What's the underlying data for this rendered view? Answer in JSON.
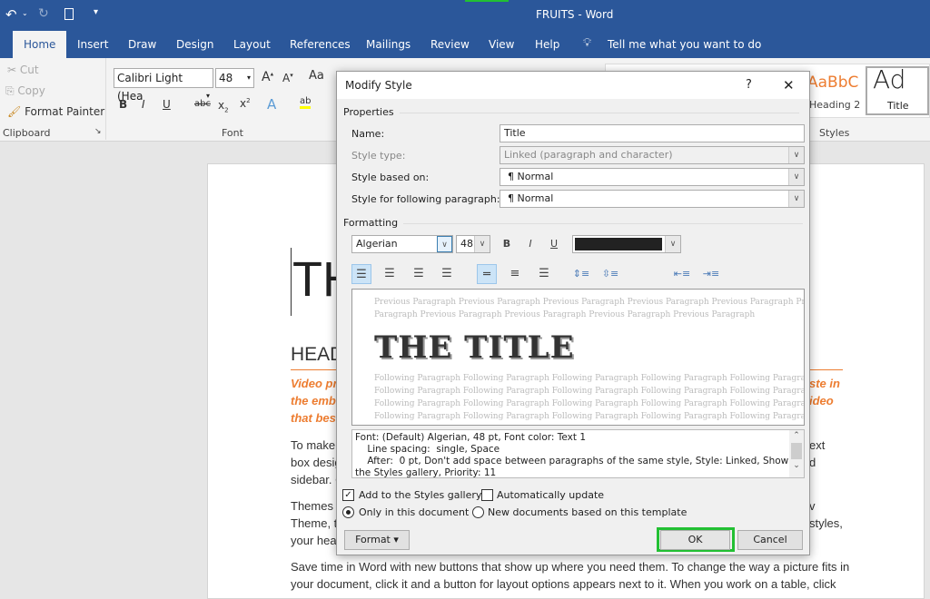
{
  "app": {
    "title": "FRUITS  -  Word",
    "qat": {
      "undo": "undo-icon",
      "redo": "redo-icon",
      "new": "new-document-icon",
      "customize": "customize-qat-icon"
    }
  },
  "tabs": [
    "Home",
    "Insert",
    "Draw",
    "Design",
    "Layout",
    "References",
    "Mailings",
    "Review",
    "View",
    "Help"
  ],
  "tell_me": "Tell me what you want to do",
  "ribbon": {
    "clipboard": {
      "cut": "Cut",
      "copy": "Copy",
      "format_painter": "Format Painter",
      "label": "Clipboard"
    },
    "font": {
      "name": "Calibri Light (Hea",
      "size": "48",
      "label": "Font",
      "case": "Aa"
    },
    "styles": {
      "heading2_preview": "AaBbC",
      "heading2": "Heading 2",
      "title_preview": "Ad",
      "title": "Title",
      "label": "Styles"
    }
  },
  "document": {
    "title_frag": "TH",
    "heading_frag": "HEAD",
    "left": [
      "Video pro",
      "the embe",
      "that best",
      "To make",
      "box desig",
      "sidebar. C",
      "Themes a",
      "Theme, th",
      "your head"
    ],
    "right": [
      "ste in",
      "ideo",
      "ext",
      "d",
      "v",
      "styles,"
    ],
    "bottom": [
      "Save time in Word with new buttons that show up where you need them. To change the way a picture fits in",
      "your document, click it and a button for layout options appears next to it. When you work on a table, click"
    ]
  },
  "dialog": {
    "title": "Modify Style",
    "help": "?",
    "close": "✕",
    "properties": "Properties",
    "name_label": "Name:",
    "name_value": "Title",
    "type_label": "Style type:",
    "type_value": "Linked (paragraph and character)",
    "based_label": "Style based on:",
    "based_value": "¶  Normal",
    "following_label": "Style for following paragraph:",
    "following_value": "¶  Normal",
    "formatting": "Formatting",
    "font": "Algerian",
    "size": "48",
    "bold": "B",
    "italic": "I",
    "underline": "U",
    "font_color": "#222222",
    "preview": {
      "previous": [
        "Previous Paragraph Previous Paragraph Previous Paragraph Previous Paragraph Previous Paragraph Previous",
        "Paragraph Previous Paragraph Previous Paragraph Previous Paragraph Previous Paragraph"
      ],
      "sample": "THE TITLE",
      "following": [
        "Following Paragraph Following Paragraph Following Paragraph Following Paragraph Following Paragraph",
        "Following Paragraph Following Paragraph Following Paragraph Following Paragraph Following Paragraph",
        "Following Paragraph Following Paragraph Following Paragraph Following Paragraph Following Paragraph",
        "Following Paragraph Following Paragraph Following Paragraph Following Paragraph Following Paragraph"
      ]
    },
    "description": [
      "Font: (Default) Algerian, 48 pt, Font color: Text 1",
      "    Line spacing:  single, Space",
      "    After:  0 pt, Don't add space between paragraphs of the same style, Style: Linked, Show in",
      "the Styles gallery, Priority: 11"
    ],
    "add_gallery": "Add to the Styles gallery",
    "add_gallery_checked": true,
    "auto_update": "Automatically update",
    "auto_update_checked": false,
    "only_doc": "Only in this document",
    "new_docs": "New documents based on this template",
    "selected_scope": "Only in this document",
    "format_btn": "Format ▾",
    "ok": "OK",
    "cancel": "Cancel",
    "highlight_color": "#22c033"
  }
}
